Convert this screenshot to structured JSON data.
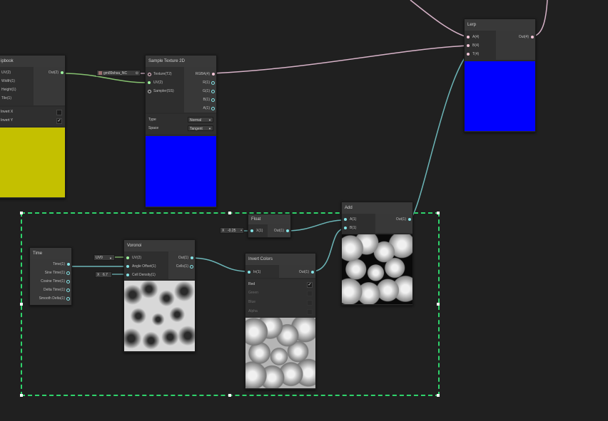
{
  "colors": {
    "canvas": "#202020",
    "edge_vector4": "#d7b3c8",
    "edge_vector2": "#85c06f",
    "edge_vector1": "#6cb6b8",
    "preview_blue": "#0000ff",
    "preview_yellow": "#c4c000",
    "group_outline": "#2fd36b"
  },
  "flipbook": {
    "title": "ipbook",
    "inputs": [
      "UV(2)",
      "Width(1)",
      "Height(1)",
      "Tile(1)"
    ],
    "outputs": [
      "Out(2)"
    ],
    "settings": [
      {
        "label": "Invert X",
        "checked": false
      },
      {
        "label": "Invert Y",
        "checked": true
      }
    ]
  },
  "texture_field": {
    "label": "gm89shsa_NC"
  },
  "sample_texture": {
    "title": "Sample Texture 2D",
    "inputs": [
      "Texture(T2)",
      "UV(2)",
      "Sampler(SS)"
    ],
    "outputs": [
      "RGBA(4)",
      "R(1)",
      "G(1)",
      "B(1)",
      "A(1)"
    ],
    "type_label": "Type",
    "type_value": "Normal",
    "space_label": "Space",
    "space_value": "Tangent"
  },
  "lerp": {
    "title": "Lerp",
    "inputs": [
      "A(4)",
      "B(4)",
      "T(4)"
    ],
    "outputs": [
      "Out(4)"
    ]
  },
  "add": {
    "title": "Add",
    "inputs": [
      "A(1)",
      "B(1)"
    ],
    "outputs": [
      "Out(1)"
    ]
  },
  "float_node": {
    "title": "Float",
    "field_axis": "X",
    "field_value": "-0.25",
    "inputs": [
      "X(1)"
    ],
    "outputs": [
      "Out(1)"
    ]
  },
  "time": {
    "title": "Time",
    "outputs": [
      "Time(1)",
      "Sine Time(1)",
      "Cosine Time(1)",
      "Delta Time(1)",
      "Smooth Delta(1)"
    ]
  },
  "voronoi": {
    "title": "Voronoi",
    "uv_field": "UV0",
    "cell_density_axis": "X",
    "cell_density_value": "6.7",
    "inputs": [
      "UV(2)",
      "Angle Offset(1)",
      "Cell Density(1)"
    ],
    "outputs": [
      "Out(1)",
      "Cells(1)"
    ]
  },
  "invert_colors": {
    "title": "Invert Colors",
    "inputs": [
      "In(1)"
    ],
    "outputs": [
      "Out(1)"
    ],
    "channels": [
      {
        "label": "Red",
        "checked": true,
        "enabled": true
      },
      {
        "label": "Green",
        "checked": false,
        "enabled": false
      },
      {
        "label": "Blue",
        "checked": false,
        "enabled": false
      },
      {
        "label": "Alpha",
        "checked": false,
        "enabled": false
      }
    ]
  }
}
